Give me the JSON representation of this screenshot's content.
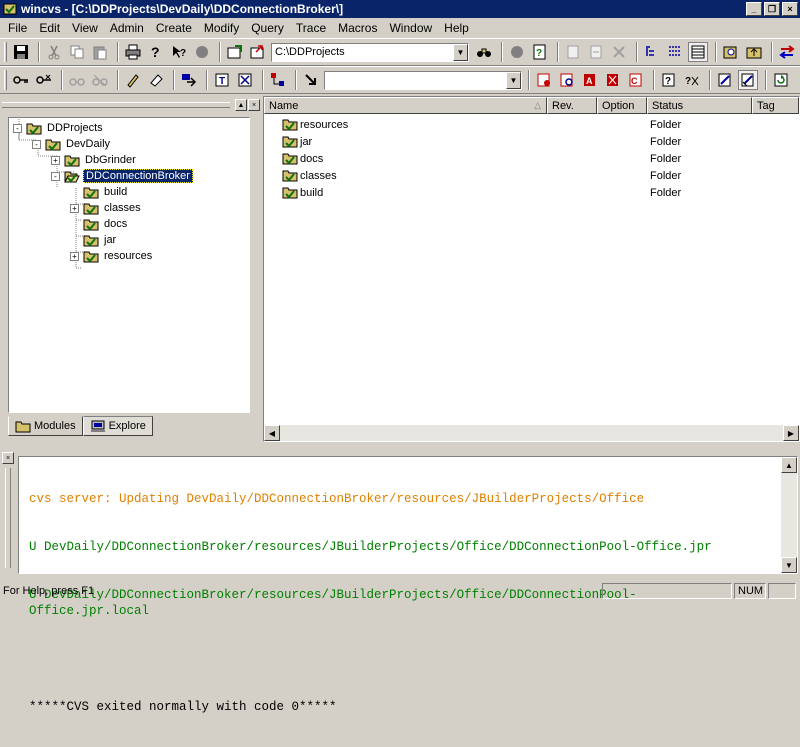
{
  "window": {
    "title": "wincvs - [C:\\DDProjects\\DevDaily\\DDConnectionBroker\\]"
  },
  "menu": [
    "File",
    "Edit",
    "View",
    "Admin",
    "Create",
    "Modify",
    "Query",
    "Trace",
    "Macros",
    "Window",
    "Help"
  ],
  "toolbar": {
    "path_combo_value": "C:\\DDProjects",
    "filter_combo_value": ""
  },
  "tree": {
    "nodes": [
      {
        "label": "DDProjects",
        "expander": "-",
        "selected": false
      },
      {
        "label": "DevDaily",
        "expander": "-",
        "selected": false
      },
      {
        "label": "DbGrinder",
        "expander": "+",
        "selected": false
      },
      {
        "label": "DDConnectionBroker",
        "expander": "-",
        "selected": true
      },
      {
        "label": "build",
        "expander": "",
        "selected": false
      },
      {
        "label": "classes",
        "expander": "+",
        "selected": false
      },
      {
        "label": "docs",
        "expander": "",
        "selected": false
      },
      {
        "label": "jar",
        "expander": "",
        "selected": false
      },
      {
        "label": "resources",
        "expander": "+",
        "selected": false
      }
    ]
  },
  "tabs": {
    "modules": "Modules",
    "explore": "Explore"
  },
  "filelist": {
    "columns": [
      "Name",
      "Rev.",
      "Option",
      "Status",
      "Tag"
    ],
    "rows": [
      {
        "name": "resources",
        "status": "Folder"
      },
      {
        "name": "jar",
        "status": "Folder"
      },
      {
        "name": "docs",
        "status": "Folder"
      },
      {
        "name": "classes",
        "status": "Folder"
      },
      {
        "name": "build",
        "status": "Folder"
      }
    ]
  },
  "output": {
    "lines": [
      {
        "text": "cvs server: Updating DevDaily/DDConnectionBroker/resources/JBuilderProjects/Office",
        "color": "#e08000"
      },
      {
        "text": "U DevDaily/DDConnectionBroker/resources/JBuilderProjects/Office/DDConnectionPool-Office.jpr",
        "color": "#008000"
      },
      {
        "text": "U DevDaily/DDConnectionBroker/resources/JBuilderProjects/Office/DDConnectionPool-\nOffice.jpr.local",
        "color": "#008000"
      },
      {
        "text": "",
        "color": "#000000"
      },
      {
        "text": "*****CVS exited normally with code 0*****",
        "color": "#000000"
      }
    ]
  },
  "statusbar": {
    "help": "For Help, press F1",
    "num": "NUM"
  },
  "colors": {
    "title_bg": "#0a246a",
    "face": "#d4d0c8",
    "folder": "#d6c26a",
    "check": "#107010"
  }
}
